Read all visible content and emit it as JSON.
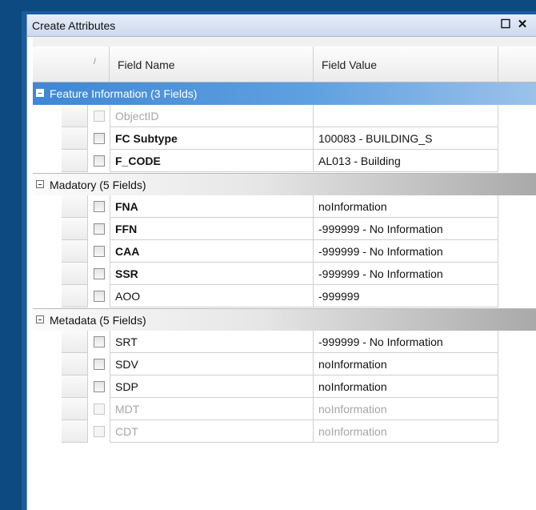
{
  "window": {
    "title": "Create Attributes",
    "controls": [
      {
        "name": "restore",
        "glyph": "☐"
      },
      {
        "name": "close",
        "glyph": "✕"
      }
    ]
  },
  "columns": {
    "sort_glyph": "/",
    "field_name": "Field Name",
    "field_value": "Field Value"
  },
  "groups": [
    {
      "title": "Feature Information (3 Fields)",
      "active": true,
      "rows": [
        {
          "name": "ObjectID",
          "value": "",
          "bold": false,
          "dim": true
        },
        {
          "name": "FC Subtype",
          "value": "100083 - BUILDING_S",
          "bold": true,
          "dim": false
        },
        {
          "name": "F_CODE",
          "value": "AL013 - Building",
          "bold": true,
          "dim": false
        }
      ]
    },
    {
      "title": "Madatory (5 Fields)",
      "active": false,
      "rows": [
        {
          "name": "FNA",
          "value": "noInformation",
          "bold": true,
          "dim": false
        },
        {
          "name": "FFN",
          "value": "-999999 - No Information",
          "bold": true,
          "dim": false
        },
        {
          "name": "CAA",
          "value": "-999999 - No Information",
          "bold": true,
          "dim": false
        },
        {
          "name": "SSR",
          "value": "-999999 - No Information",
          "bold": true,
          "dim": false
        },
        {
          "name": "AOO",
          "value": "-999999",
          "bold": false,
          "dim": false
        }
      ]
    },
    {
      "title": "Metadata (5 Fields)",
      "active": false,
      "rows": [
        {
          "name": "SRT",
          "value": "-999999 - No Information",
          "bold": false,
          "dim": false
        },
        {
          "name": "SDV",
          "value": "noInformation",
          "bold": false,
          "dim": false
        },
        {
          "name": "SDP",
          "value": "noInformation",
          "bold": false,
          "dim": false
        },
        {
          "name": "MDT",
          "value": "noInformation",
          "bold": false,
          "dim": true
        },
        {
          "name": "CDT",
          "value": "noInformation",
          "bold": false,
          "dim": true
        }
      ]
    }
  ]
}
